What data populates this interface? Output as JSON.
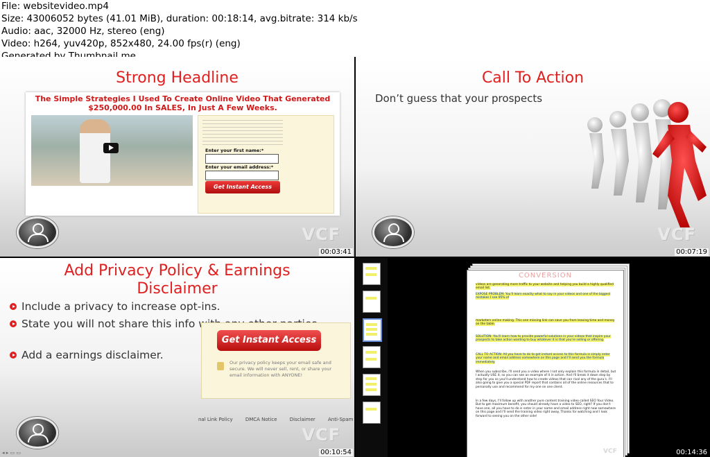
{
  "header": {
    "lines": [
      "File: websitevideo.mp4",
      "Size: 43006052 bytes (41.01 MiB), duration: 00:18:14, avg.bitrate: 314 kb/s",
      "Audio: aac, 32000 Hz, stereo (eng)",
      "Video: h264, yuv420p, 852x480, 24.00 fps(r) (eng)",
      "Generated by Thumbnail me"
    ]
  },
  "frames": [
    {
      "title": "Strong Headline",
      "timestamp": "00:03:41",
      "landing_headline": "The Simple Strategies I Used To Create Online Video That Generated $250,000.00 In SALES, In Just A Few Weeks.",
      "form_name_label": "Enter your first name:*",
      "form_email_label": "Enter your email address:*",
      "button_label": "Get Instant Access",
      "logo_text": "VCF"
    },
    {
      "title": "Call To Action",
      "subtitle": "Don’t guess that your prospects",
      "timestamp": "00:07:19",
      "logo_text": "VCF"
    },
    {
      "title": "Add Privacy Policy & Earnings Disclaimer",
      "bullets": [
        "Include a privacy to increase opt-ins.",
        "State you will not share this info with any other parties.",
        "Add a earnings disclaimer."
      ],
      "button_label": "Get Instant Access",
      "privacy_text": "Our privacy policy keeps your email safe and secure. We will never sell, rent, or share your email information with ANYONE!",
      "footer_links": [
        "nal Link Policy",
        "DMCA Notice",
        "Disclaimer",
        "Anti-Spam Policy"
      ],
      "timestamp": "00:10:54",
      "logo_text": "VCF"
    },
    {
      "doc_title": "CONVERSION",
      "paragraphs": [
        "videos are generating more traffic to your website and helping you build a highly qualified email list.",
        "EXPOSE PROBLEM: You'll learn exactly what to say in your videos and one of the biggest mistakes I see 95% of",
        "marketers online making. This one missing link can save you from leaving time and money on the table.",
        "SOLUTION: You'll learn how to provide powerful solutions in your videos that inspire your prospects to take action wanting to buy whatever it is that you're selling or offering.",
        "CALL TO ACTION: All you have to do to get instant access to this formula is simply enter your name and email address somewhere on this page and I'll send you the formula immediately.",
        "When you subscribe, I'll send you a video where I not only explain this formula in detail, but I actually USE it, so you can see an example of it in action. And I'll break it down step by step for you so you'll understand how to create videos that can rival any of the guru's. I'll also going to give you a special PDF report that contains all of the online resources that to personally use and recommend for my one on one client.",
        "In a few days, I'll follow up with another pure content training video called SEO Your Video. But to get maximum benefit, you should already have a video to SEO, right? If you don't have one, all you have to do is enter in your name and email address right now somewhere on this page and I'll send the training video right away. Thanks for watching and I look forward to seeing you on the other side!"
      ],
      "timestamp": "00:14:36",
      "logo_text": "VCF"
    }
  ]
}
